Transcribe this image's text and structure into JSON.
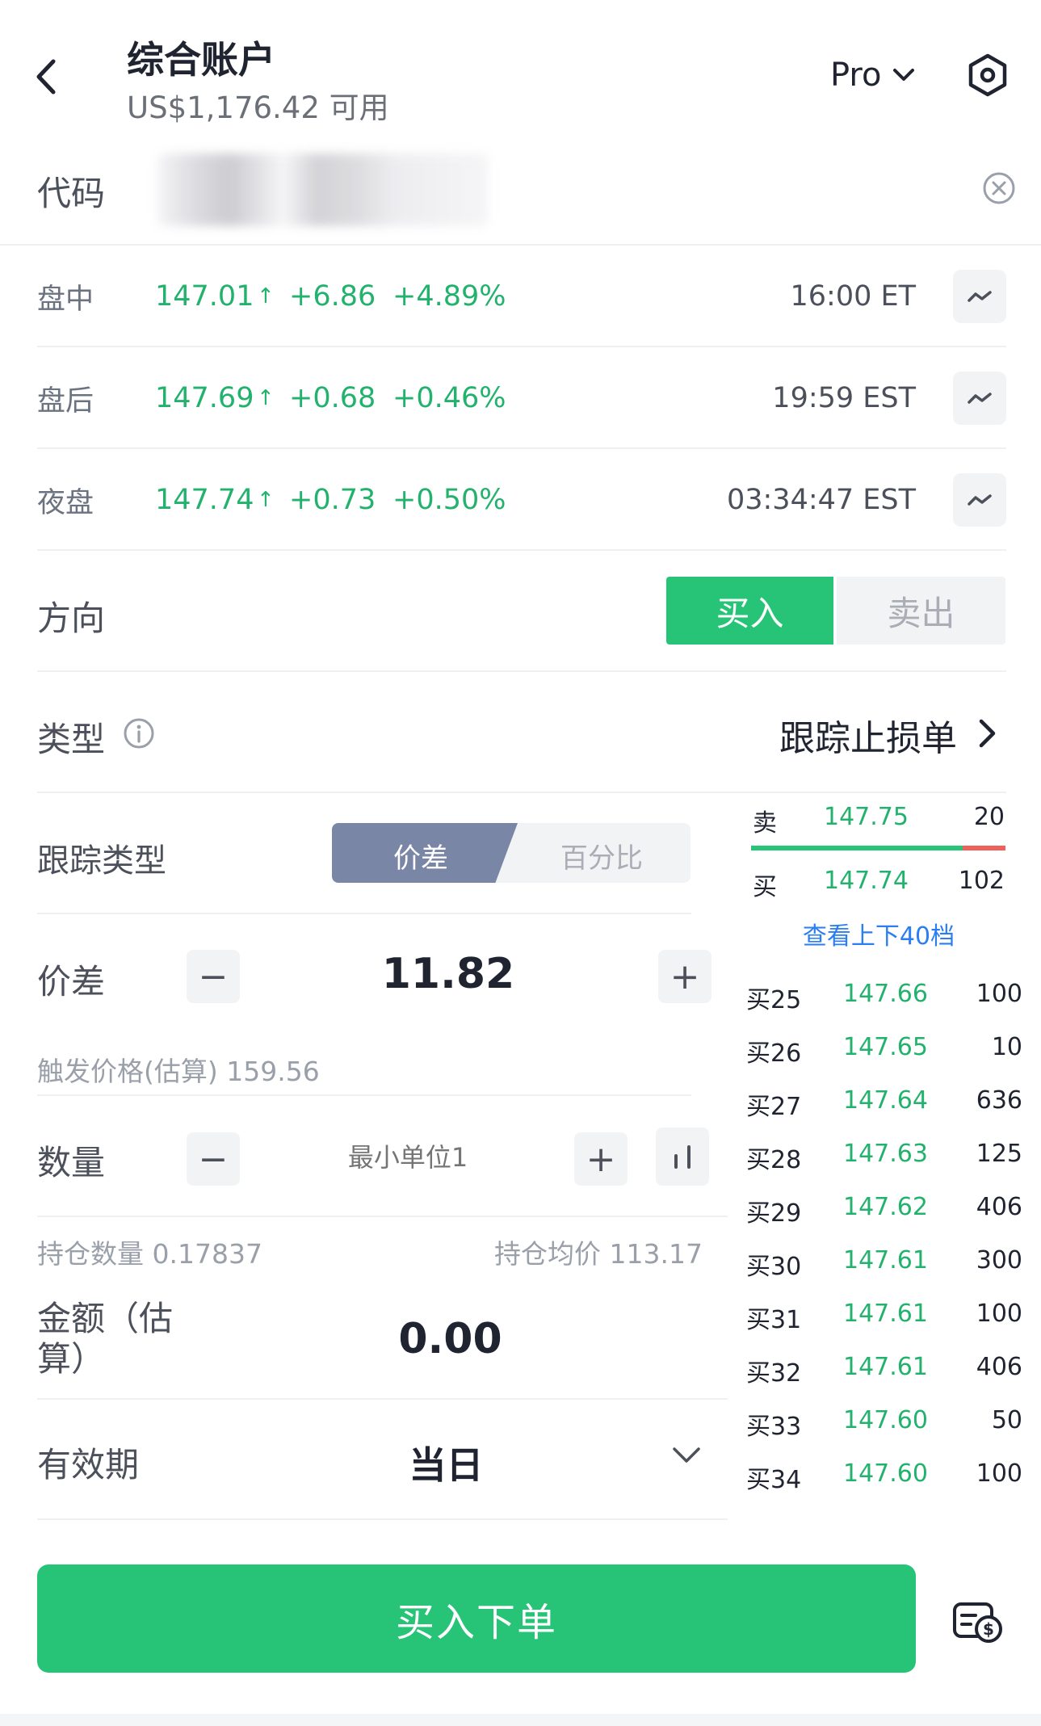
{
  "header": {
    "title": "综合账户",
    "subtitle": "US$1,176.42 可用",
    "mode": "Pro"
  },
  "code": {
    "label": "代码"
  },
  "quotes": [
    {
      "label": "盘中",
      "price": "147.01",
      "arrow": "↑",
      "change": "+6.86",
      "pct": "+4.89%",
      "time": "16:00 ET"
    },
    {
      "label": "盘后",
      "price": "147.69",
      "arrow": "↑",
      "change": "+0.68",
      "pct": "+0.46%",
      "time": "19:59 EST"
    },
    {
      "label": "夜盘",
      "price": "147.74",
      "arrow": "↑",
      "change": "+0.73",
      "pct": "+0.50%",
      "time": "03:34:47 EST"
    }
  ],
  "direction": {
    "label": "方向",
    "buy": "买入",
    "sell": "卖出"
  },
  "type": {
    "label": "类型",
    "value": "跟踪止损单"
  },
  "trail": {
    "label": "跟踪类型",
    "option_spread": "价差",
    "option_percent": "百分比"
  },
  "spread": {
    "label": "价差",
    "value": "11.82",
    "minus": "−",
    "plus": "+",
    "trigger": "触发价格(估算) 159.56"
  },
  "quantity": {
    "label": "数量",
    "placeholder": "最小单位1",
    "minus": "−",
    "plus": "+",
    "hold_qty": "持仓数量 0.17837",
    "hold_avg": "持仓均价 113.17"
  },
  "amount": {
    "label": "金额（估算）",
    "value": "0.00"
  },
  "validity": {
    "label": "有效期",
    "value": "当日"
  },
  "orderbook": {
    "ask": {
      "side": "卖",
      "price": "147.75",
      "size": "20"
    },
    "bid": {
      "side": "买",
      "price": "147.74",
      "size": "102"
    },
    "more": "查看上下40档",
    "levels": [
      {
        "level": "买25",
        "price": "147.66",
        "size": "100"
      },
      {
        "level": "买26",
        "price": "147.65",
        "size": "10"
      },
      {
        "level": "买27",
        "price": "147.64",
        "size": "636"
      },
      {
        "level": "买28",
        "price": "147.63",
        "size": "125"
      },
      {
        "level": "买29",
        "price": "147.62",
        "size": "406"
      },
      {
        "level": "买30",
        "price": "147.61",
        "size": "300"
      },
      {
        "level": "买31",
        "price": "147.61",
        "size": "100"
      },
      {
        "level": "买32",
        "price": "147.61",
        "size": "406"
      },
      {
        "level": "买33",
        "price": "147.60",
        "size": "50"
      },
      {
        "level": "买34",
        "price": "147.60",
        "size": "100"
      }
    ]
  },
  "submit": {
    "label": "买入下单"
  },
  "colors": {
    "accent_green": "#27c376",
    "price_green": "#23b26d",
    "link_blue": "#2b7ef2",
    "ask_red": "#f0605a",
    "segment_active": "#7a86a6"
  }
}
